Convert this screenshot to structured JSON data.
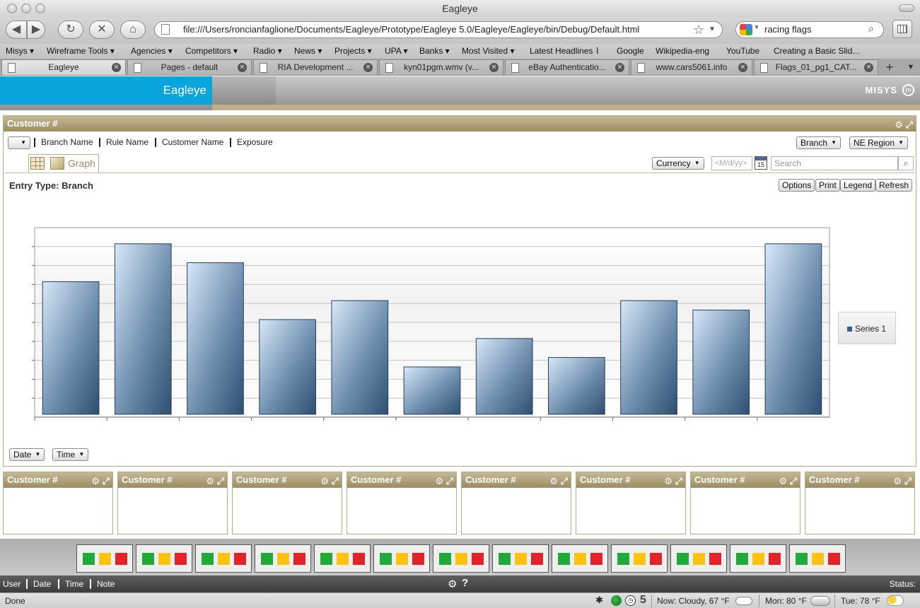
{
  "window": {
    "title": "Eagleye"
  },
  "toolbar": {
    "back_icon": "back-arrow-icon",
    "forward_icon": "forward-arrow-icon",
    "reload_icon": "reload-icon",
    "stop_icon": "stop-icon",
    "home_icon": "home-icon",
    "url": "file:///Users/roncianfaglione/Documents/Eagleye/Prototype/Eagleye 5.0/Eagleye/Eagleye/bin/Debug/Default.html",
    "search_value": "racing flags"
  },
  "bookmarks": [
    {
      "label": "Misys ▾"
    },
    {
      "label": "Wireframe Tools ▾"
    },
    {
      "label": "Agencies ▾"
    },
    {
      "label": "Competitors ▾"
    },
    {
      "label": "Radio ▾"
    },
    {
      "label": "News ▾"
    },
    {
      "label": "Projects ▾"
    },
    {
      "label": "UPA ▾"
    },
    {
      "label": "Banks ▾"
    },
    {
      "label": "Most Visited ▾"
    },
    {
      "label": "Latest Headlines ⌇"
    },
    {
      "label": "Google"
    },
    {
      "label": "Wikipedia-eng"
    },
    {
      "label": "YouTube"
    },
    {
      "label": "Creating a Basic Slid..."
    }
  ],
  "tabs": [
    {
      "label": "Eagleye",
      "active": true
    },
    {
      "label": "Pages - default"
    },
    {
      "label": "RIA Development ..."
    },
    {
      "label": "kyn01pgm.wmv (v..."
    },
    {
      "label": "eBay Authenticatio..."
    },
    {
      "label": "www.cars5061.info"
    },
    {
      "label": "Flags_01_pg1_CAT..."
    }
  ],
  "app": {
    "brand": "Eagleye",
    "logo_text": "MISYS",
    "accent_color": "#0aa5dd",
    "panel_color": "#a99b6e"
  },
  "main_panel": {
    "title": "Customer #",
    "filter_fields": [
      "Branch Name",
      "Rule Name",
      "Customer Name",
      "Exposure"
    ],
    "branch_dropdown": "Branch",
    "region_dropdown": "NE Region",
    "graph_tab": "Graph",
    "currency_dropdown": "Currency",
    "date_placeholder": "<M/d/yy>",
    "calendar_day": "15",
    "search_placeholder": "Search",
    "entry_type_label": "Entry Type: Branch",
    "buttons": {
      "options": "Options",
      "print": "Print",
      "legend": "Legend",
      "refresh": "Refresh"
    },
    "date_dropdown": "Date",
    "time_dropdown": "Time"
  },
  "chart_data": {
    "type": "bar",
    "categories": [
      "",
      "",
      "",
      "",
      "",
      "",
      "",
      "",
      "",
      "",
      ""
    ],
    "series": [
      {
        "name": "Series 1",
        "values": [
          7,
          9,
          8,
          5,
          6,
          2.5,
          4,
          3,
          6,
          5.5,
          9
        ]
      }
    ],
    "ylim": [
      0,
      10
    ],
    "grid": true,
    "legend": "right"
  },
  "small_panels": [
    {
      "title": "Customer #"
    },
    {
      "title": "Customer #"
    },
    {
      "title": "Customer #"
    },
    {
      "title": "Customer #"
    },
    {
      "title": "Customer #"
    },
    {
      "title": "Customer #"
    },
    {
      "title": "Customer #"
    },
    {
      "title": "Customer #"
    }
  ],
  "indicator_colors": {
    "green": "#1faa3a",
    "yellow": "#ffc20e",
    "red": "#e2232a"
  },
  "indicator_count": 13,
  "status_row": {
    "labels": [
      "User",
      "Date",
      "Time",
      "Note"
    ],
    "status_label": "Status:"
  },
  "browser_status": {
    "left": "Done",
    "tab_count": "5",
    "weather_now": "Now: Cloudy, 67 °F",
    "weather_mon": "Mon: 80 °F",
    "weather_tue": "Tue: 78 °F"
  }
}
